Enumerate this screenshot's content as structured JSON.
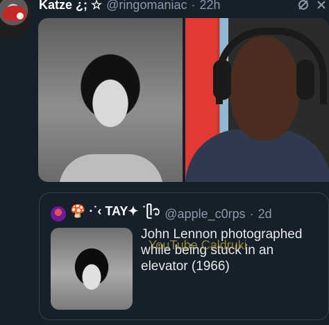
{
  "post": {
    "display_name": "Katze ¿; ☆",
    "handle": "@ringomaniac",
    "separator": "·",
    "time": "22h"
  },
  "quoted": {
    "display_name": "🍄 ·˙‹ TAY✦ ˙ᥫ᭡",
    "handle": "@apple_c0rps",
    "separator": "·",
    "time": "2d",
    "text": "John Lennon photographed while being stuck in an elevator (1966)"
  },
  "watermark": "YouTube Caldruki",
  "icons": [
    "avatar",
    "grok-icon",
    "close-icon"
  ],
  "colors": {
    "background": "#15202b",
    "text": "#e7e9ea",
    "muted": "#8b98a5",
    "border": "#38444d"
  }
}
